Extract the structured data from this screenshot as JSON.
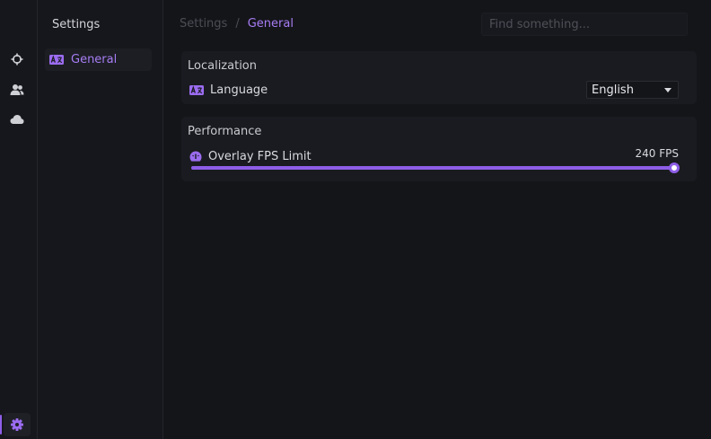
{
  "rail": {
    "icons": [
      "crosshair-icon",
      "users-icon",
      "cloud-icon",
      "gear-icon"
    ],
    "active": "gear-icon"
  },
  "sidebar": {
    "title": "Settings",
    "items": [
      {
        "label": "General",
        "icon": "language-icon",
        "active": true
      }
    ]
  },
  "breadcrumb": {
    "parent": "Settings",
    "separator": "/",
    "current": "General"
  },
  "search": {
    "placeholder": "Find something..."
  },
  "sections": {
    "localization": {
      "title": "Localization",
      "language": {
        "label": "Language",
        "icon": "language-icon",
        "value": "English"
      }
    },
    "performance": {
      "title": "Performance",
      "fps": {
        "label": "Overlay FPS Limit",
        "icon": "gauge-icon",
        "value_text": "240 FPS",
        "fraction": 1.0
      }
    }
  },
  "colors": {
    "accent": "#8e5ee8",
    "accent_text": "#a77df3",
    "background": "#141519",
    "panel": "#1a1b20"
  }
}
